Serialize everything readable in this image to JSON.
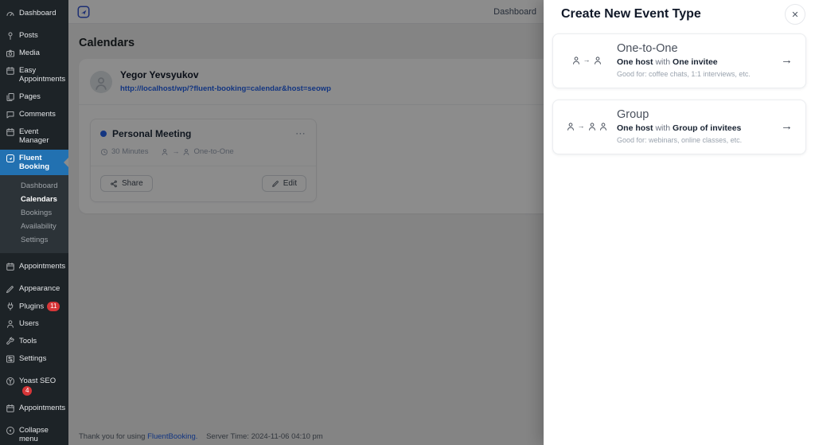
{
  "sidebar": {
    "items": [
      {
        "label": "Dashboard",
        "icon": "dashboard-icon"
      },
      {
        "label": "Posts",
        "icon": "pin-icon"
      },
      {
        "label": "Media",
        "icon": "camera-icon"
      },
      {
        "label": "Easy Appointments",
        "icon": "calendar-icon"
      },
      {
        "label": "Pages",
        "icon": "pages-icon"
      },
      {
        "label": "Comments",
        "icon": "comment-icon"
      },
      {
        "label": "Event Manager",
        "icon": "calendar-icon"
      },
      {
        "label": "Fluent Booking",
        "icon": "fluent-booking-icon",
        "active": true
      },
      {
        "label": "Appointments",
        "icon": "calendar-icon"
      },
      {
        "label": "Appearance",
        "icon": "brush-icon"
      },
      {
        "label": "Plugins",
        "icon": "plug-icon",
        "badge": "11"
      },
      {
        "label": "Users",
        "icon": "user-icon"
      },
      {
        "label": "Tools",
        "icon": "wrench-icon"
      },
      {
        "label": "Settings",
        "icon": "sliders-icon"
      },
      {
        "label": "Yoast SEO",
        "icon": "yoast-icon",
        "badge": "4"
      },
      {
        "label": "Appointments",
        "icon": "calendar-icon"
      },
      {
        "label": "Collapse menu",
        "icon": "collapse-icon"
      }
    ],
    "fluent_submenu": {
      "items": [
        "Dashboard",
        "Calendars",
        "Bookings",
        "Availability",
        "Settings"
      ],
      "active": "Calendars"
    }
  },
  "header": {
    "nav": [
      {
        "label": "Dashboard"
      }
    ]
  },
  "page": {
    "title": "Calendars"
  },
  "calendar": {
    "host_name": "Yegor Yevsyukov",
    "host_url": "http://localhost/wp/?fluent-booking=calendar&host=seowp",
    "event": {
      "title": "Personal Meeting",
      "duration": "30 Minutes",
      "type": "One-to-One",
      "share_label": "Share",
      "edit_label": "Edit"
    }
  },
  "footer": {
    "thanks_text": "Thank you for using",
    "brand": "FluentBooking.",
    "server_time": "Server Time: 2024-11-06 04:10 pm"
  },
  "drawer": {
    "title": "Create New Event Type",
    "options": [
      {
        "title": "One-to-One",
        "host_part": "One host",
        "connector": "with",
        "invitee_part": "One invitee",
        "description": "Good for: coffee chats, 1:1 interviews, etc.",
        "icon": "one-to-one-icon"
      },
      {
        "title": "Group",
        "host_part": "One host",
        "connector": "with",
        "invitee_part": "Group of invitees",
        "description": "Good for: webinars, online classes, etc.",
        "icon": "group-icon"
      }
    ]
  },
  "glyphs": {
    "close": "✕",
    "arrow": "→",
    "ellipsis": "⋯"
  },
  "colors": {
    "accent_blue": "#2271b1",
    "brand_blue": "#3454d1",
    "badge_red": "#d63638",
    "link_blue": "#2563eb",
    "event_dot": "#2563eb",
    "sidebar_bg": "#1d2327",
    "submenu_bg": "#2c3338"
  }
}
